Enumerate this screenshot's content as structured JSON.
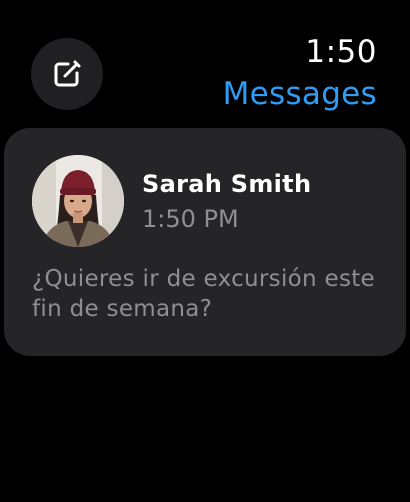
{
  "status": {
    "time": "1:50"
  },
  "app": {
    "title": "Messages",
    "accent_color": "#2f9cf5"
  },
  "compose": {
    "icon": "compose-icon"
  },
  "notification": {
    "sender": "Sarah Smith",
    "time": "1:50 PM",
    "message": "¿Quieres ir de excursión este fin de semana?",
    "avatar": "contact-photo"
  }
}
